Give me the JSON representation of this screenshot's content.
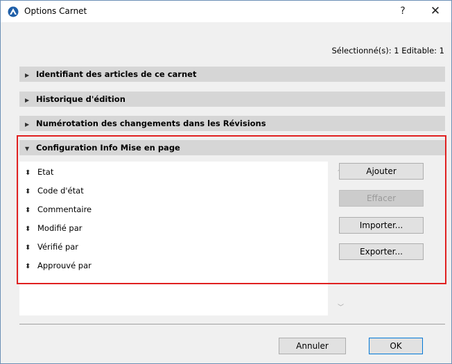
{
  "window": {
    "title": "Options Carnet",
    "help_label": "?",
    "close_label": "✕"
  },
  "status": {
    "selection": "Sélectionné(s): 1 Editable: 1"
  },
  "sections": [
    {
      "label": "Identifiant des articles de ce carnet",
      "expanded": false
    },
    {
      "label": "Historique d'édition",
      "expanded": false
    },
    {
      "label": "Numérotation des changements dans les Révisions",
      "expanded": false
    },
    {
      "label": "Configuration Info Mise en page",
      "expanded": true
    }
  ],
  "list": {
    "items": [
      "Etat",
      "Code d'état",
      "Commentaire",
      "Modifié par",
      "Vérifié par",
      "Approuvé par"
    ]
  },
  "side_buttons": {
    "add": "Ajouter",
    "delete": "Effacer",
    "import": "Importer...",
    "export": "Exporter..."
  },
  "footer": {
    "cancel": "Annuler",
    "ok": "OK"
  },
  "colors": {
    "highlight": "#e02020",
    "ok_border": "#0078d7",
    "title_bar": "#ffffff",
    "section_header": "#d6d6d6"
  }
}
